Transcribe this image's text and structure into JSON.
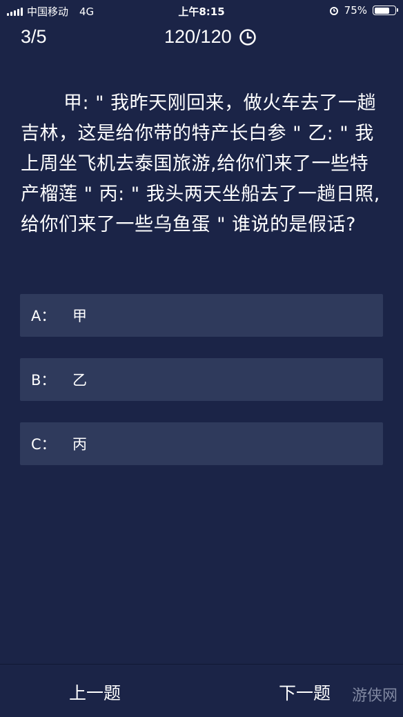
{
  "status": {
    "carrier": "中国移动",
    "network": "4G",
    "time": "上午8:15",
    "battery": "75%",
    "battery_level": 0.75
  },
  "header": {
    "progress": "3/5",
    "timer": "120/120"
  },
  "question": "甲: \" 我昨天刚回来，做火车去了一趟吉林，这是给你带的特产长白参 \"  乙: \" 我上周坐飞机去泰国旅游,给你们来了一些特产榴莲 \"  丙: \" 我头两天坐船去了一趟日照,给你们来了一些乌鱼蛋 \"  谁说的是假话?",
  "options": [
    {
      "key": "A：",
      "value": "甲"
    },
    {
      "key": "B：",
      "value": "乙"
    },
    {
      "key": "C：",
      "value": "丙"
    }
  ],
  "nav": {
    "prev": "上一题",
    "next": "下一题"
  },
  "watermark": "游侠网"
}
